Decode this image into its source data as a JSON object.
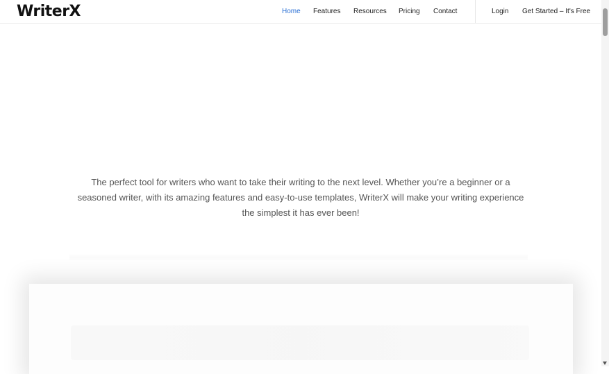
{
  "brand": {
    "name": "WriterX"
  },
  "nav": {
    "items": [
      {
        "label": "Home",
        "active": true
      },
      {
        "label": "Features"
      },
      {
        "label": "Resources"
      },
      {
        "label": "Pricing"
      },
      {
        "label": "Contact"
      }
    ],
    "login": "Login",
    "cta": "Get Started – It's Free",
    "active_color": "#2a6fd4"
  },
  "hero": {
    "line1": "The perfect tool for writers who want to take their writing to the next level. Whether you’re a beginner or a",
    "line2": "seasoned writer, with its amazing features and easy-to-use templates, WriterX will make your writing experience",
    "line3": "the simplest it has ever been!"
  }
}
